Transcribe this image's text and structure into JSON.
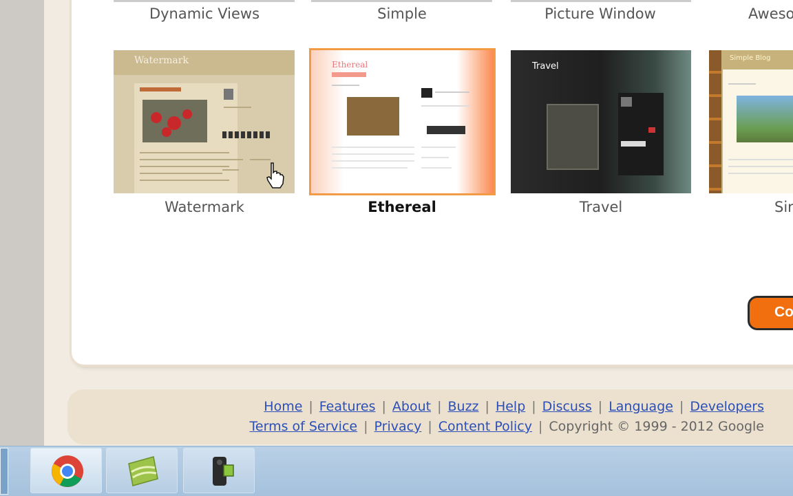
{
  "templates_row1": [
    {
      "label": "Dynamic Views"
    },
    {
      "label": "Simple"
    },
    {
      "label": "Picture Window"
    },
    {
      "label": "Aweso"
    }
  ],
  "templates_row2": [
    {
      "label": "Watermark",
      "thumb_title": "Watermark",
      "selected": false
    },
    {
      "label": "Ethereal",
      "thumb_title": "Ethereal",
      "selected": true
    },
    {
      "label": "Travel",
      "thumb_title": "Travel",
      "selected": false
    },
    {
      "label": "Sir",
      "thumb_title": "Simple Blog",
      "selected": false
    }
  ],
  "continue_button": {
    "label": "Co"
  },
  "footer": {
    "links_row1": [
      "Home",
      "Features",
      "About",
      "Buzz",
      "Help",
      "Discuss",
      "Language",
      "Developers"
    ],
    "links_row2": [
      "Terms of Service",
      "Privacy",
      "Content Policy"
    ],
    "copyright": "Copyright © 1999 - 2012 Google",
    "separator": "|"
  },
  "taskbar": {
    "apps": [
      "chrome-icon",
      "app-leaf-icon",
      "video-camera-icon"
    ]
  },
  "colors": {
    "accent_orange": "#f26f10",
    "selection_outline": "#f39a44",
    "link_blue": "#2a4fb8",
    "footer_bg": "#ece0cf"
  }
}
